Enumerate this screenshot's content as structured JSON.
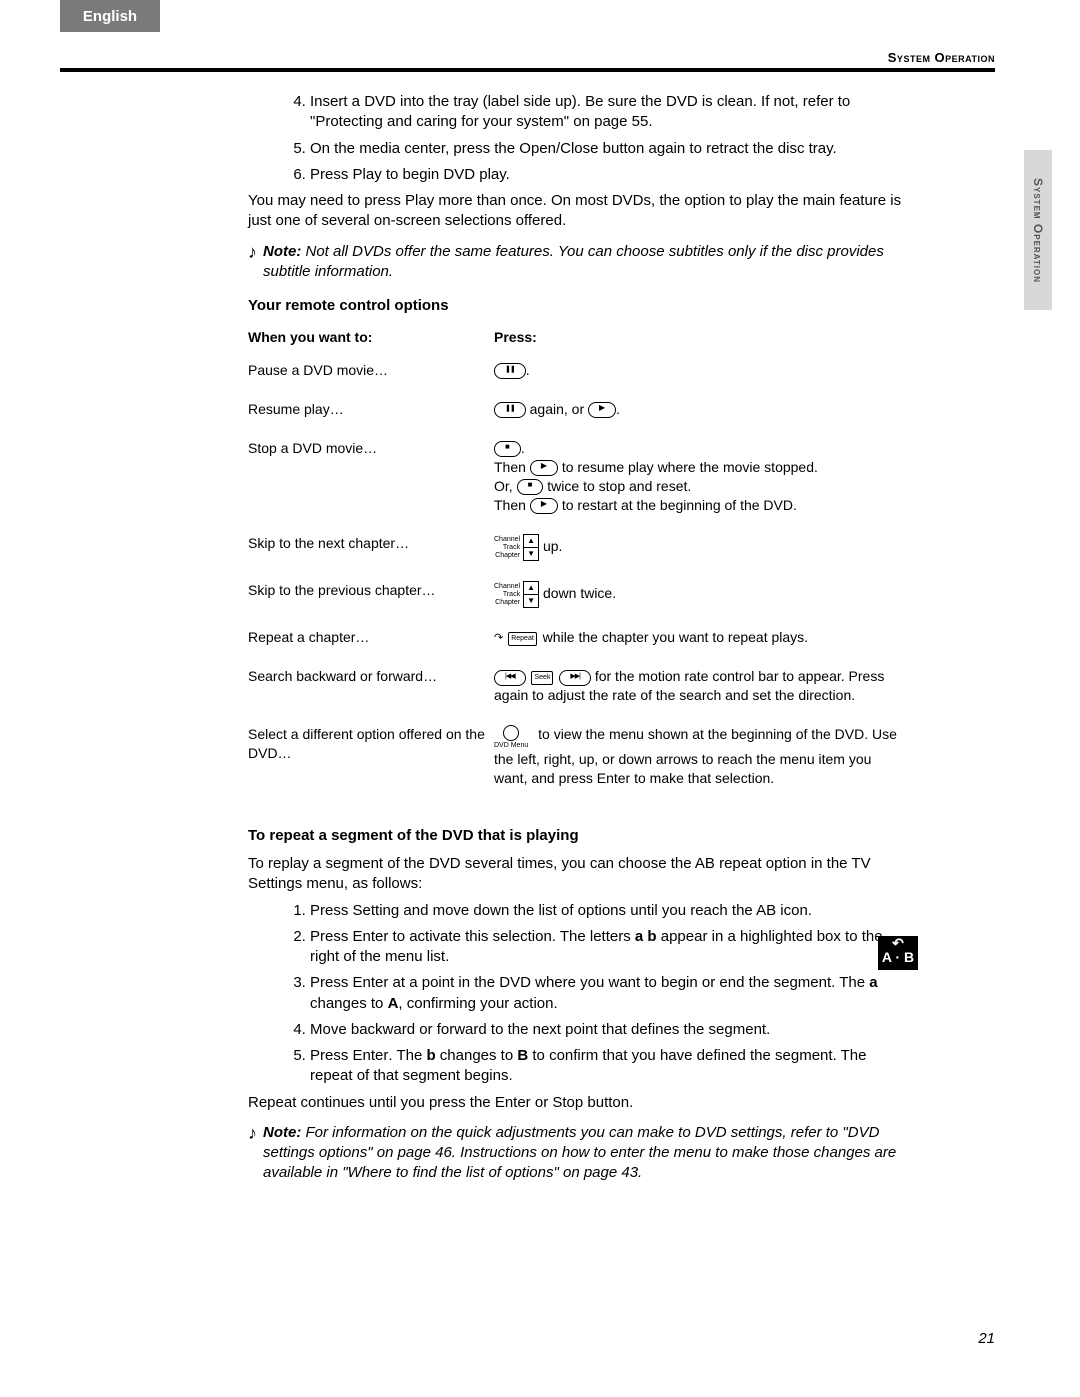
{
  "lang_tab": "English",
  "header_right": "System Operation",
  "side_tab": "System Operation",
  "page_number": "21",
  "steps_a": [
    "Insert a DVD into the tray (label side up). Be sure the DVD is clean. If not, refer to \"Protecting and caring for your system\" on page 55.",
    "On the media center, press the Open/Close button again to retract the disc tray."
  ],
  "step_a6_pre": "Press ",
  "step_a6_play": "Play",
  "step_a6_post": " to begin DVD play.",
  "para_after_steps_pre": "You may need to press ",
  "para_after_steps_play": "Play",
  "para_after_steps_post": " more than once. On most DVDs, the option to play the main feature is just one of several on-screen selections offered.",
  "note1_label": "Note:",
  "note1_text": " Not all DVDs offer the same features. You can choose subtitles only if the disc provides subtitle information.",
  "heading_remote": "Your remote control options",
  "table": {
    "col1": "When you want to:",
    "col2": "Press:",
    "row1_a": "Pause a DVD movie…",
    "row2_a": "Resume play…",
    "row2_b_mid": " again, or ",
    "row3_a": "Stop a DVD movie…",
    "row3_b_then1": "Then ",
    "row3_b_then1_post": " to resume play where the movie stopped.",
    "row3_b_or": "Or, ",
    "row3_b_or_post": " twice to stop and reset.",
    "row3_b_then2": "Then ",
    "row3_b_then2_post": " to restart at the beginning of the DVD.",
    "row4_a": "Skip to the next chapter…",
    "row4_b": " up.",
    "row5_a": "Skip to the previous chapter…",
    "row5_b": " down twice.",
    "row6_a": "Repeat a chapter…",
    "row6_b": " while the chapter you want to repeat plays.",
    "row7_a": "Search backward or forward…",
    "row7_b": " for the motion rate control bar to appear. Press again to adjust the rate of the search and set the direction.",
    "row8_a": "Select a different option offered on the DVD…",
    "row8_b_pre": " to view the menu shown at the beginning of the DVD. Use the left, right, up, or down arrows to reach the menu item you want, and press ",
    "row8_b_enter": "Enter",
    "row8_b_post": " to make that selection."
  },
  "chan_lbl": "Channel\nTrack\nChapter",
  "repeat_btn": "Repeat",
  "seek_btn": "Seek",
  "dvd_menu_btn": "DVD Menu",
  "heading_repeat": "To repeat a segment of the DVD that is playing",
  "para_repeat_intro": "To replay a segment of the DVD several times, you can choose the AB repeat option in the TV Settings menu, as follows:",
  "rsteps": {
    "s1_pre": "Press ",
    "s1_setting": "Setting",
    "s1_post": " and move down the list of options until you reach the AB icon.",
    "s2_pre": "Press ",
    "s2_enter": "Enter",
    "s2_mid": " to activate this selection. The letters ",
    "s2_ab": "a b",
    "s2_post": " appear in a highlighted box to the right of the menu list.",
    "s3_pre": "Press ",
    "s3_enter": "Enter",
    "s3_mid": " at a point in the DVD where you want to begin or end the segment. The ",
    "s3_a": "a",
    "s3_mid2": " changes to ",
    "s3_A": "A",
    "s3_post": ", confirming your action.",
    "s4": "Move backward or forward to the next point that defines the segment.",
    "s5_pre": "Press ",
    "s5_enter": "Enter",
    "s5_mid": ". The ",
    "s5_b": "b",
    "s5_mid2": " changes to ",
    "s5_B": "B",
    "s5_post": " to confirm that you have defined the segment. The repeat of that segment begins."
  },
  "para_repeat_end_pre": "Repeat continues until you press the ",
  "para_repeat_end_enter": "Enter",
  "para_repeat_end_post": " or Stop button.",
  "note2_label": "Note:",
  "note2_text": " For information on the quick adjustments you can make to DVD settings, refer to \"DVD settings options\" on page 46. Instructions on how to enter the menu to make those changes are available in \"Where to find the list of options\" on page 43.",
  "ab_icon": "A · B"
}
